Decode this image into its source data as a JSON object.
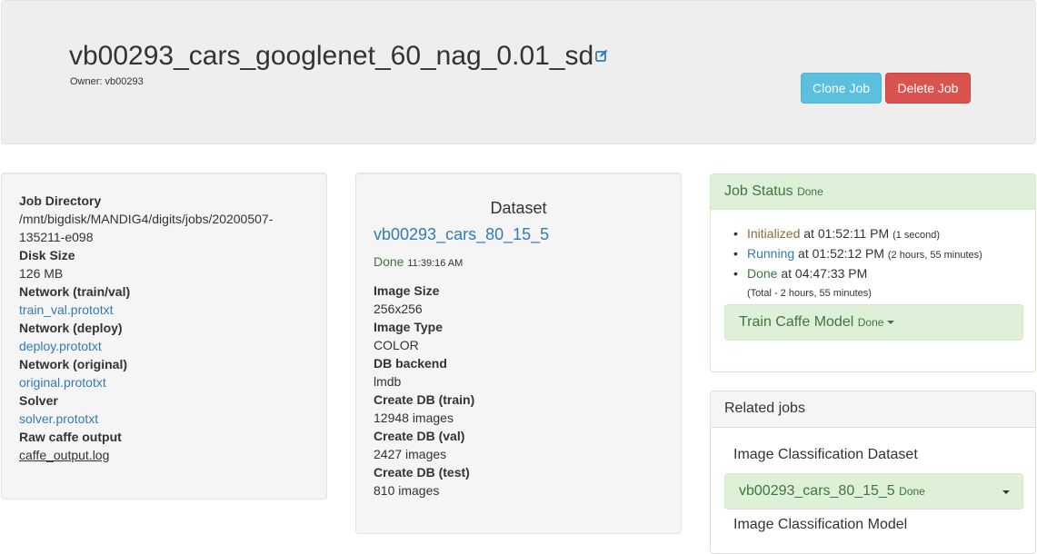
{
  "header": {
    "title": "vb00293_cars_googlenet_60_nag_0.01_sd",
    "owner": "Owner: vb00293",
    "clone_label": "Clone Job",
    "delete_label": "Delete Job"
  },
  "job_info": {
    "dir_label": "Job Directory",
    "dir_value_1": "/mnt/bigdisk/MANDIG4/digits/jobs/20200507-",
    "dir_value_2": "135211-e098",
    "disk_label": "Disk Size",
    "disk_value": "126 MB",
    "net_trainval_label": "Network (train/val)",
    "net_trainval_link": "train_val.prototxt",
    "net_deploy_label": "Network (deploy)",
    "net_deploy_link": "deploy.prototxt",
    "net_original_label": "Network (original)",
    "net_original_link": "original.prototxt",
    "solver_label": "Solver",
    "solver_link": "solver.prototxt",
    "raw_label": "Raw caffe output",
    "raw_link": "caffe_output.log"
  },
  "dataset": {
    "heading": "Dataset",
    "name": "vb00293_cars_80_15_5",
    "status": "Done",
    "status_time": "11:39:16 AM",
    "image_size_label": "Image Size",
    "image_size": "256x256",
    "image_type_label": "Image Type",
    "image_type": "COLOR",
    "backend_label": "DB backend",
    "backend": "lmdb",
    "train_label": "Create DB (train)",
    "train": "12948 images",
    "val_label": "Create DB (val)",
    "val": "2427 images",
    "test_label": "Create DB (test)",
    "test": "810 images"
  },
  "job_status": {
    "heading": "Job Status",
    "heading_status": "Done",
    "items": [
      {
        "state": "Initialized",
        "at": " at 01:52:11 PM ",
        "dur": "(1 second)"
      },
      {
        "state": "Running",
        "at": " at 01:52:12 PM ",
        "dur": "(2 hours, 55 minutes)"
      },
      {
        "state": "Done",
        "at": " at 04:47:33 PM",
        "dur": ""
      }
    ],
    "total": "(Total - 2 hours, 55 minutes)",
    "train_label": "Train Caffe Model",
    "train_status": "Done"
  },
  "related": {
    "heading": "Related jobs",
    "dataset_label": "Image Classification Dataset",
    "dataset_name": "vb00293_cars_80_15_5",
    "dataset_status": "Done",
    "model_label": "Image Classification Model"
  },
  "colors": {
    "clone": "#5bc0de",
    "delete": "#d9534f",
    "success_bg": "#dff0d8",
    "success_text": "#3c763d",
    "link": "#337ab7"
  }
}
